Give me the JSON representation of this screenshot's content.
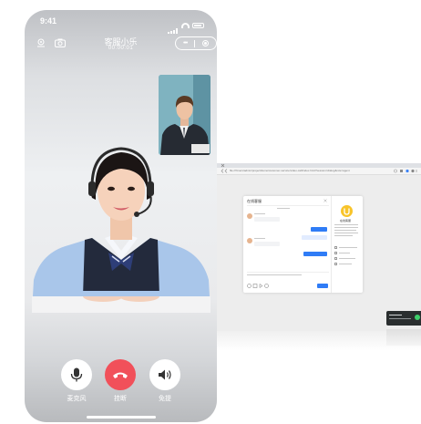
{
  "phone": {
    "status_time": "9:41",
    "title": "客服小乐",
    "timer": "00:00:01",
    "controls": [
      {
        "id": "mic",
        "label": "麦克风",
        "icon": "microphone-icon"
      },
      {
        "id": "hangup",
        "label": "挂断",
        "icon": "phone-hangup-icon"
      },
      {
        "id": "speaker",
        "label": "免提",
        "icon": "speaker-icon"
      }
    ],
    "colors": {
      "hangup": "#f1505a",
      "button": "#ffffff"
    }
  },
  "browser": {
    "url": "file:///Users/admin/project/demo/customer-service/video-call/index.html?session=dialog&role=agent",
    "dialog": {
      "header": "在线客服",
      "brand_name": "在线客服"
    }
  }
}
